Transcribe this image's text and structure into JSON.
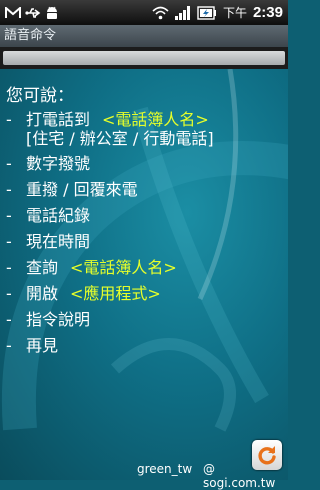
{
  "status_bar": {
    "icons_left": [
      "gmail-icon",
      "usb-icon",
      "android-debug-icon"
    ],
    "icons_right": [
      "wifi-icon",
      "signal-icon",
      "battery-icon"
    ],
    "ampm": "下午",
    "time": "2:39"
  },
  "title": "語音命令",
  "prompt": "您可說：",
  "bullet": "-",
  "commands": [
    {
      "text": "打電話到",
      "highlight": "<電話簿人名>",
      "sub": "[住宅 / 辦公室 / 行動電話]"
    },
    {
      "text": "數字撥號"
    },
    {
      "text": "重撥 / 回覆來電"
    },
    {
      "text": "電話紀錄"
    },
    {
      "text": "現在時間"
    },
    {
      "text": "查詢",
      "highlight": "<電話簿人名>"
    },
    {
      "text": "開啟",
      "highlight": "<應用程式>"
    },
    {
      "text": "指令說明"
    },
    {
      "text": "再見"
    }
  ],
  "footer": {
    "user": "green_tw",
    "site": "@ sogi.com.tw"
  },
  "colors": {
    "background": "#0d5f72",
    "highlight": "#e6ff2a",
    "text": "#ffffff"
  }
}
